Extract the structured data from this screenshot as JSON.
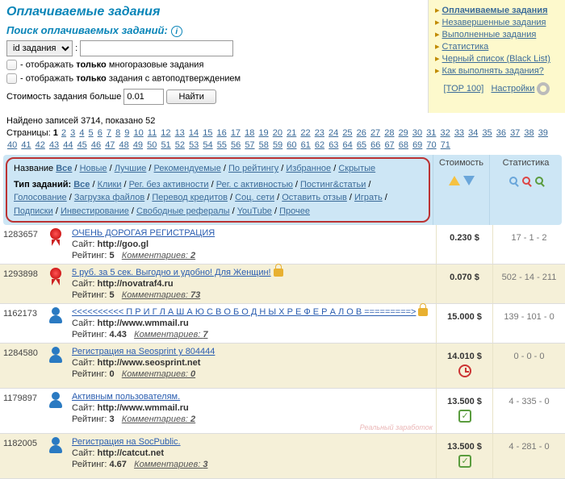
{
  "header": {
    "title": "Оплачиваемые задания",
    "search_label": "Поиск оплачиваемых заданий:"
  },
  "sidebar": [
    {
      "label": "Оплачиваемые задания",
      "bold": true
    },
    {
      "label": "Незавершенные задания"
    },
    {
      "label": "Выполненные задания"
    },
    {
      "label": "Статистика"
    },
    {
      "label": "Черный список (Black List)"
    },
    {
      "label": "Как выполнять задания?"
    }
  ],
  "top100": "[TOP 100]",
  "settings": "Настройки",
  "search": {
    "select": "id задания",
    "colon": ":",
    "chk1_pre": "- отображать ",
    "chk1_b": "только",
    "chk1_post": " многоразовые задания",
    "chk2_pre": "- отображать ",
    "chk2_b": "только",
    "chk2_post": " задания с автоподтверждением",
    "cost_lbl": "Стоимость задания больше",
    "cost_val": "0.01",
    "find": "Найти"
  },
  "found": "Найдено записей 3714, показано 52",
  "pages_lbl": "Страницы:",
  "pages": [
    "1",
    "2",
    "3",
    "4",
    "5",
    "6",
    "7",
    "8",
    "9",
    "10",
    "11",
    "12",
    "13",
    "14",
    "15",
    "16",
    "17",
    "18",
    "19",
    "20",
    "21",
    "22",
    "23",
    "24",
    "25",
    "26",
    "27",
    "28",
    "29",
    "30",
    "31",
    "32",
    "33",
    "34",
    "35",
    "36",
    "37",
    "38",
    "39",
    "40",
    "41",
    "42",
    "43",
    "44",
    "45",
    "46",
    "47",
    "48",
    "49",
    "50",
    "51",
    "52",
    "53",
    "54",
    "55",
    "56",
    "57",
    "58",
    "59",
    "60",
    "61",
    "62",
    "63",
    "64",
    "65",
    "66",
    "67",
    "68",
    "69",
    "70",
    "71"
  ],
  "filters": {
    "name_lbl": "Название",
    "name_opts": [
      "Все",
      "Новые",
      "Лучшие",
      "Рекомендуемые",
      "По рейтингу",
      "Избранное",
      "Скрытые"
    ],
    "type_lbl": "Тип заданий:",
    "type_opts": [
      "Все",
      "Клики",
      "Рег. без активности",
      "Рег. с активностью",
      "Постинг&статьи",
      "Голосование",
      "Загрузка файлов",
      "Перевод кредитов",
      "Соц. сети",
      "Оставить отзыв",
      "Играть",
      "Подписки",
      "Инвестирование",
      "Свободные рефералы",
      "YouTube",
      "Прочее"
    ]
  },
  "cols": {
    "cost": "Стоимость",
    "stat": "Статистика"
  },
  "labels": {
    "site": "Сайт:",
    "rating": "Рейтинг:",
    "comments": "Комментариев:"
  },
  "tasks": [
    {
      "id": "1283657",
      "icon": "ribbon",
      "title": "ОЧЕНЬ ДОРОГАЯ РЕГИСТРАЦИЯ",
      "site": "http://goo.gl",
      "rating": "5",
      "comments": "2",
      "cost": "0.230 $",
      "stat": "17 - 1 - 2",
      "lock": false,
      "alt": false
    },
    {
      "id": "1293898",
      "icon": "ribbon",
      "title": "5 руб. за 5 сек. Выгодно и удобно! Для Женщин!",
      "site": "http://novatraf4.ru",
      "rating": "5",
      "comments": "73",
      "cost": "0.070 $",
      "stat": "502 - 14 - 211",
      "lock": true,
      "alt": true
    },
    {
      "id": "1162173",
      "icon": "person",
      "title": "<<<<<<<<<< П Р И Г Л А Ш А Ю     С В О Б О Д Н Ы Х     Р Е Ф Е Р А Л О В =========>",
      "site": "http://www.wmmail.ru",
      "rating": "4.43",
      "comments": "7",
      "cost": "15.000 $",
      "stat": "139 - 101 - 0",
      "lock": true,
      "alt": false
    },
    {
      "id": "1284580",
      "icon": "person",
      "title": "Регистрация на Seosprint у 804444",
      "site": "http://www.seosprint.net",
      "rating": "0",
      "comments": "0",
      "cost": "14.010 $",
      "stat": "0 - 0 - 0",
      "lock": false,
      "alt": true,
      "extra": "clock"
    },
    {
      "id": "1179897",
      "icon": "person",
      "title": "Активным пользователям.",
      "site": "http://www.wmmail.ru",
      "rating": "3",
      "comments": "2",
      "cost": "13.500 $",
      "stat": "4 - 335 - 0",
      "lock": false,
      "alt": false,
      "extra": "chip",
      "wm": true
    },
    {
      "id": "1182005",
      "icon": "person",
      "title": "Регистрация на SocPublic.",
      "site": "http://catcut.net",
      "rating": "4.67",
      "comments": "3",
      "cost": "13.500 $",
      "stat": "4 - 281 - 0",
      "lock": false,
      "alt": true,
      "extra": "chip"
    }
  ]
}
